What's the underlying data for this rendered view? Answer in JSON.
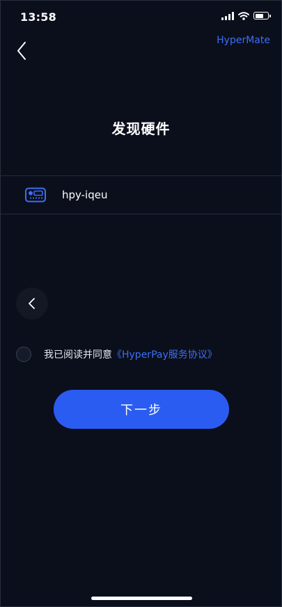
{
  "status_bar": {
    "time": "13:58",
    "icons": [
      "signal-icon",
      "wifi-icon",
      "battery-icon"
    ]
  },
  "nav": {
    "back_icon": "chevron-left-icon",
    "right_link": "HyperMate"
  },
  "title": "发现硬件",
  "device": {
    "icon": "hardware-wallet-icon",
    "name": "hpy-iqeu"
  },
  "floating_back_icon": "chevron-left-icon",
  "agreement": {
    "checked": false,
    "text": "我已阅读并同意",
    "link_text": "《HyperPay服务协议》"
  },
  "next_button": {
    "label": "下一步"
  },
  "colors": {
    "background": "#0b0f1c",
    "accent": "#2b5cf2",
    "link": "#3d6ef5",
    "divider": "#232b45"
  }
}
